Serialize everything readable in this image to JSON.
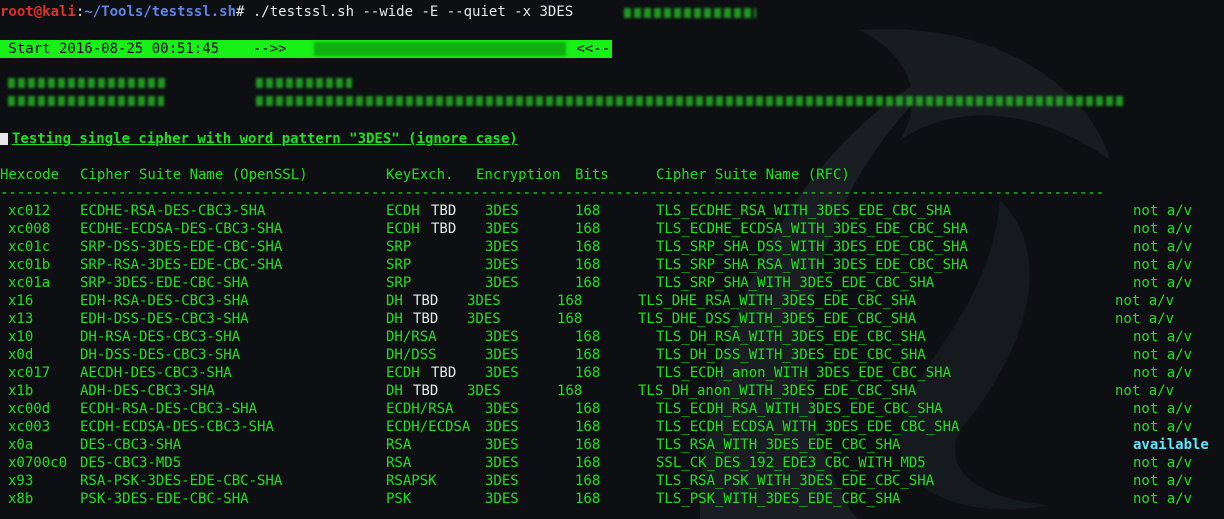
{
  "prompt": {
    "user_host": "root@kali",
    "colon": ":",
    "path": "~/Tools/testssl.sh",
    "symbol": "#",
    "command": " ./testssl.sh --wide -E --quiet -x 3DES"
  },
  "banner": {
    "start_label": " Start 2016-08-25 00:51:45    -->> ",
    "end_label": " <<--"
  },
  "heading": "Testing single cipher with word pattern \"3DES\" (ignore case) ",
  "table": {
    "headers": [
      "Hexcode",
      "Cipher Suite Name (OpenSSL)",
      "KeyExch.",
      "Encryption",
      "Bits",
      "Cipher Suite Name (RFC)"
    ],
    "separator": "--------------------------------------------------------------------------------------------------------------------------------------------------",
    "rows": [
      {
        "hex": "xc012",
        "openssl": "ECDHE-RSA-DES-CBC3-SHA",
        "kx": "ECDH",
        "kx2": "TBD",
        "enc": "3DES",
        "bits": "168",
        "rfc": "TLS_ECDHE_RSA_WITH_3DES_EDE_CBC_SHA",
        "status": "not a/v",
        "shift": false
      },
      {
        "hex": "xc008",
        "openssl": "ECDHE-ECDSA-DES-CBC3-SHA",
        "kx": "ECDH",
        "kx2": "TBD",
        "enc": "3DES",
        "bits": "168",
        "rfc": "TLS_ECDHE_ECDSA_WITH_3DES_EDE_CBC_SHA",
        "status": "not a/v",
        "shift": false
      },
      {
        "hex": "xc01c",
        "openssl": "SRP-DSS-3DES-EDE-CBC-SHA",
        "kx": "SRP",
        "kx2": "",
        "enc": "3DES",
        "bits": "168",
        "rfc": "TLS_SRP_SHA_DSS_WITH_3DES_EDE_CBC_SHA",
        "status": "not a/v",
        "shift": false
      },
      {
        "hex": "xc01b",
        "openssl": "SRP-RSA-3DES-EDE-CBC-SHA",
        "kx": "SRP",
        "kx2": "",
        "enc": "3DES",
        "bits": "168",
        "rfc": "TLS_SRP_SHA_RSA_WITH_3DES_EDE_CBC_SHA",
        "status": "not a/v",
        "shift": false
      },
      {
        "hex": "xc01a",
        "openssl": "SRP-3DES-EDE-CBC-SHA",
        "kx": "SRP",
        "kx2": "",
        "enc": "3DES",
        "bits": "168",
        "rfc": "TLS_SRP_SHA_WITH_3DES_EDE_CBC_SHA",
        "status": "not a/v",
        "shift": false
      },
      {
        "hex": "x16",
        "openssl": "EDH-RSA-DES-CBC3-SHA",
        "kx": "DH",
        "kx2": "TBD",
        "enc": "3DES",
        "bits": "168",
        "rfc": "TLS_DHE_RSA_WITH_3DES_EDE_CBC_SHA",
        "status": "not a/v",
        "shift": true
      },
      {
        "hex": "x13",
        "openssl": "EDH-DSS-DES-CBC3-SHA",
        "kx": "DH",
        "kx2": "TBD",
        "enc": "3DES",
        "bits": "168",
        "rfc": "TLS_DHE_DSS_WITH_3DES_EDE_CBC_SHA",
        "status": "not a/v",
        "shift": true
      },
      {
        "hex": "x10",
        "openssl": "DH-RSA-DES-CBC3-SHA",
        "kx": "DH/RSA",
        "kx2": "",
        "enc": "3DES",
        "bits": "168",
        "rfc": "TLS_DH_RSA_WITH_3DES_EDE_CBC_SHA",
        "status": "not a/v",
        "shift": false
      },
      {
        "hex": "x0d",
        "openssl": "DH-DSS-DES-CBC3-SHA",
        "kx": "DH/DSS",
        "kx2": "",
        "enc": "3DES",
        "bits": "168",
        "rfc": "TLS_DH_DSS_WITH_3DES_EDE_CBC_SHA",
        "status": "not a/v",
        "shift": false
      },
      {
        "hex": "xc017",
        "openssl": "AECDH-DES-CBC3-SHA",
        "kx": "ECDH",
        "kx2": "TBD",
        "enc": "3DES",
        "bits": "168",
        "rfc": "TLS_ECDH_anon_WITH_3DES_EDE_CBC_SHA",
        "status": "not a/v",
        "shift": false
      },
      {
        "hex": "x1b",
        "openssl": "ADH-DES-CBC3-SHA",
        "kx": "DH",
        "kx2": "TBD",
        "enc": "3DES",
        "bits": "168",
        "rfc": "TLS_DH_anon_WITH_3DES_EDE_CBC_SHA",
        "status": "not a/v",
        "shift": true
      },
      {
        "hex": "xc00d",
        "openssl": "ECDH-RSA-DES-CBC3-SHA",
        "kx": "ECDH/RSA",
        "kx2": "",
        "enc": "3DES",
        "bits": "168",
        "rfc": "TLS_ECDH_RSA_WITH_3DES_EDE_CBC_SHA",
        "status": "not a/v",
        "shift": false
      },
      {
        "hex": "xc003",
        "openssl": "ECDH-ECDSA-DES-CBC3-SHA",
        "kx": "ECDH/ECDSA",
        "kx2": "",
        "enc": "3DES",
        "bits": "168",
        "rfc": "TLS_ECDH_ECDSA_WITH_3DES_EDE_CBC_SHA",
        "status": "not a/v",
        "shift": false
      },
      {
        "hex": "x0a",
        "openssl": "DES-CBC3-SHA",
        "kx": "RSA",
        "kx2": "",
        "enc": "3DES",
        "bits": "168",
        "rfc": "TLS_RSA_WITH_3DES_EDE_CBC_SHA",
        "status": "available",
        "shift": false
      },
      {
        "hex": "x0700c0",
        "openssl": "DES-CBC3-MD5",
        "kx": "RSA",
        "kx2": "",
        "enc": "3DES",
        "bits": "168",
        "rfc": "SSL_CK_DES_192_EDE3_CBC_WITH_MD5",
        "status": "not a/v",
        "shift": false
      },
      {
        "hex": "x93",
        "openssl": "RSA-PSK-3DES-EDE-CBC-SHA",
        "kx": "RSAPSK",
        "kx2": "",
        "enc": "3DES",
        "bits": "168",
        "rfc": "TLS_RSA_PSK_WITH_3DES_EDE_CBC_SHA",
        "status": "not a/v",
        "shift": false
      },
      {
        "hex": "x8b",
        "openssl": "PSK-3DES-EDE-CBC-SHA",
        "kx": "PSK",
        "kx2": "",
        "enc": "3DES",
        "bits": "168",
        "rfc": "TLS_PSK_WITH_3DES_EDE_CBC_SHA",
        "status": "not a/v",
        "shift": false
      }
    ]
  },
  "colors": {
    "background": "#0d0f12",
    "text_green": "#1fe01f",
    "banner_green": "#18f018",
    "available": "#5ee6ff",
    "prompt_red": "#e0312b",
    "prompt_blue": "#5d86e8"
  }
}
